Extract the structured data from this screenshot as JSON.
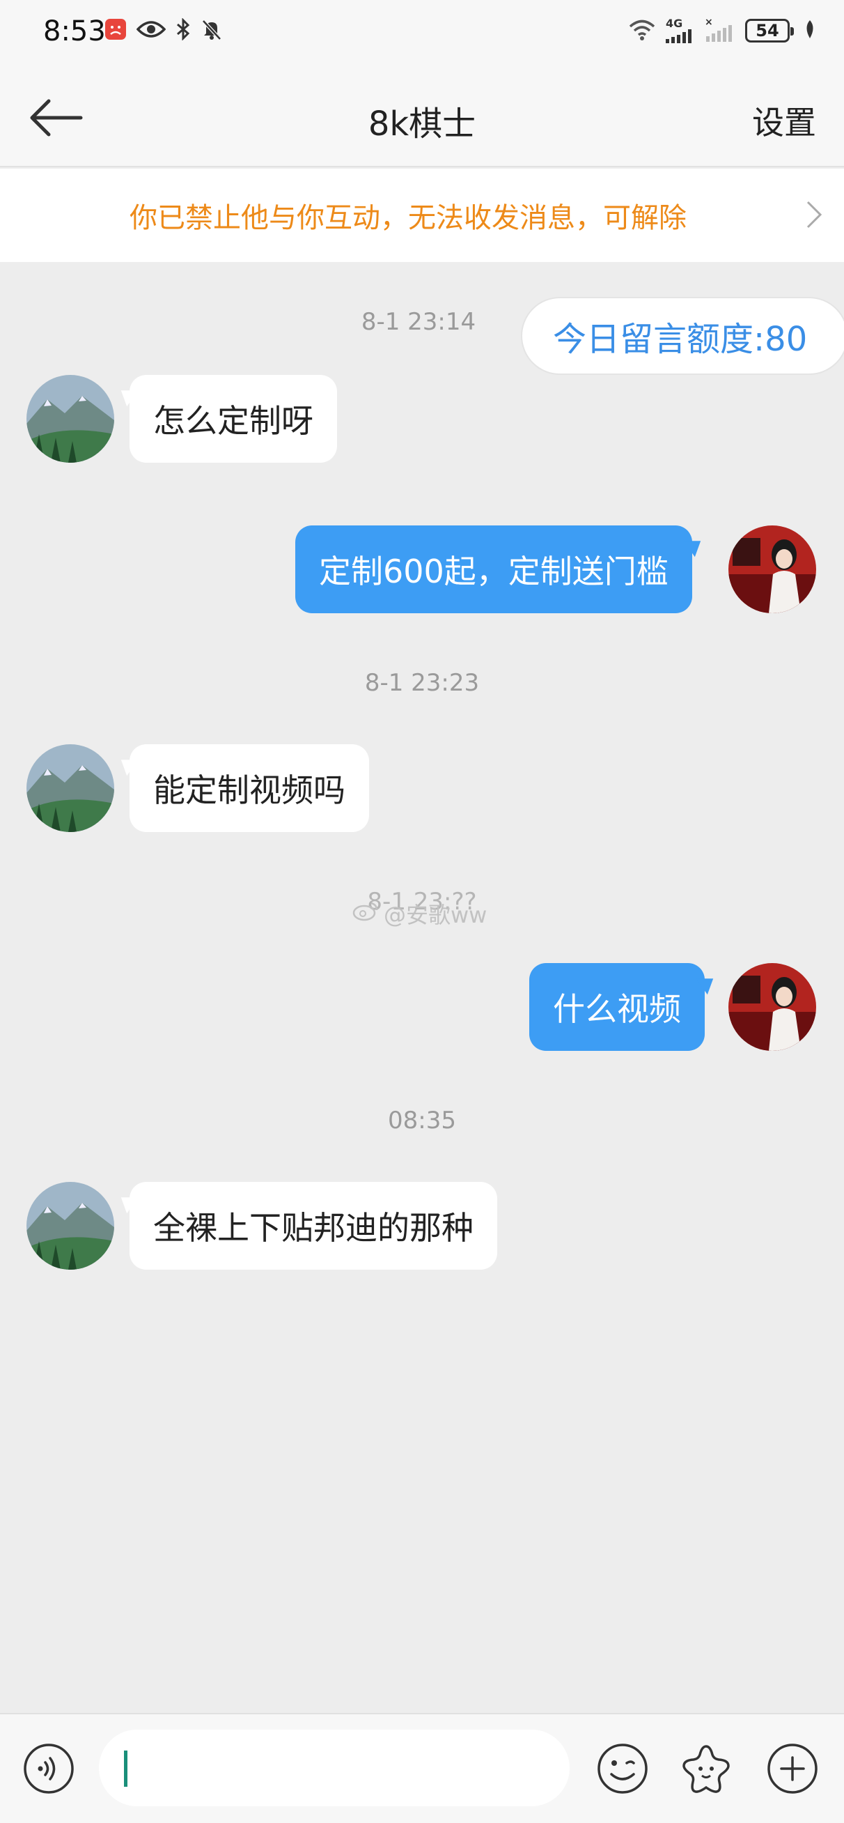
{
  "status_bar": {
    "time": "8:53",
    "battery": "54",
    "network": "4G",
    "icons": [
      "app-notification-icon",
      "eye-icon",
      "bluetooth-icon",
      "mute-icon",
      "wifi-icon",
      "signal-icon",
      "no-signal-icon",
      "battery-icon",
      "leaf-icon"
    ]
  },
  "header": {
    "title": "8k棋士",
    "settings_label": "设置",
    "back_icon": "arrow-left-icon"
  },
  "banner": {
    "text": "你已禁止他与你互动，无法收发消息，可解除",
    "color": "#ed8a19"
  },
  "quota": {
    "text": "今日留言额度:80"
  },
  "messages": [
    {
      "type": "timestamp",
      "text": "8-1 23:14"
    },
    {
      "type": "in",
      "text": "怎么定制呀"
    },
    {
      "type": "out",
      "text": "定制600起，定制送门槛"
    },
    {
      "type": "timestamp",
      "text": "8-1 23:23"
    },
    {
      "type": "in",
      "text": "能定制视频吗"
    },
    {
      "type": "timestamp",
      "text": "8-1 23:??"
    },
    {
      "type": "out",
      "text": "什么视频"
    },
    {
      "type": "timestamp",
      "text": "08:35"
    },
    {
      "type": "in",
      "text": "全裸上下贴邦迪的那种"
    }
  ],
  "watermark": {
    "text": "@安歌ww"
  },
  "input_bar": {
    "voice_icon": "voice-icon",
    "emoji_icon": "emoji-icon",
    "sticker_icon": "star-sticker-icon",
    "add_icon": "plus-icon",
    "value": ""
  },
  "colors": {
    "accent_blue": "#3d9df4",
    "quota_text": "#3a8ee6",
    "background": "#ededed"
  }
}
